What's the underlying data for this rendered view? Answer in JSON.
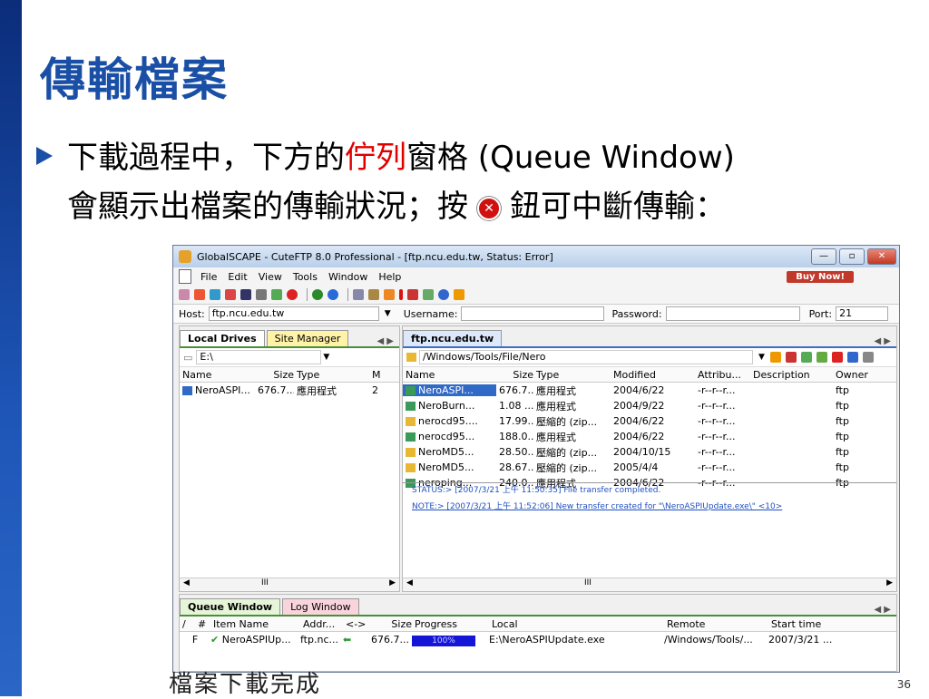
{
  "slide": {
    "title": "傳輸檔案",
    "line1_before": "下載過程中，下方的",
    "line1_red": "佇列",
    "line1_after": "窗格 (Queue Window)",
    "line2_before": "會顯示出檔案的傳輸狀況；按",
    "line2_after": "鈕可中斷傳輸：",
    "caption": "檔案下載完成",
    "page_number": "36"
  },
  "window": {
    "title": "GlobalSCAPE - CuteFTP 8.0 Professional - [ftp.ncu.edu.tw, Status: Error]",
    "menu": [
      "File",
      "Edit",
      "View",
      "Tools",
      "Window",
      "Help"
    ],
    "buy_now": "Buy Now!",
    "host_label": "Host:",
    "host_value": "ftp.ncu.edu.tw",
    "username_label": "Username:",
    "password_label": "Password:",
    "port_label": "Port:",
    "port_value": "21",
    "colors": {
      "accent": "#3169c6",
      "brand": "#1a4fa6",
      "error": "#d01010"
    }
  },
  "local": {
    "tabs": [
      "Local Drives",
      "Site Manager"
    ],
    "path": "E:\\",
    "headers": [
      "Name",
      "Size",
      "Type",
      "M"
    ],
    "rows": [
      {
        "name": "NeroASPI...",
        "size": "676.7...",
        "type": "應用程式",
        "m": "2"
      }
    ],
    "scroll": "III"
  },
  "remote": {
    "tab": "ftp.ncu.edu.tw",
    "path": "/Windows/Tools/File/Nero",
    "headers": [
      "Name",
      "Size",
      "Type",
      "Modified",
      "Attribu...",
      "Description",
      "Owner"
    ],
    "rows": [
      {
        "name": "NeroASPI...",
        "size": "676.7...",
        "type": "應用程式",
        "modified": "2004/6/22",
        "attr": "-r--r--r...",
        "owner": "ftp"
      },
      {
        "name": "NeroBurn...",
        "size": "1.08 ...",
        "type": "應用程式",
        "modified": "2004/9/22",
        "attr": "-r--r--r...",
        "owner": "ftp"
      },
      {
        "name": "nerocd95....",
        "size": "17.99...",
        "type": "壓縮的 (zip...",
        "modified": "2004/6/22",
        "attr": "-r--r--r...",
        "owner": "ftp"
      },
      {
        "name": "nerocd95...",
        "size": "188.0...",
        "type": "應用程式",
        "modified": "2004/6/22",
        "attr": "-r--r--r...",
        "owner": "ftp"
      },
      {
        "name": "NeroMD5...",
        "size": "28.50...",
        "type": "壓縮的 (zip...",
        "modified": "2004/10/15",
        "attr": "-r--r--r...",
        "owner": "ftp"
      },
      {
        "name": "NeroMD5...",
        "size": "28.67...",
        "type": "壓縮的 (zip...",
        "modified": "2005/4/4",
        "attr": "-r--r--r...",
        "owner": "ftp"
      },
      {
        "name": "neroping...",
        "size": "240.0...",
        "type": "應用程式",
        "modified": "2004/6/22",
        "attr": "-r--r--r...",
        "owner": "ftp"
      }
    ],
    "scroll": "III",
    "log": [
      "STATUS:>          [2007/3/21 上午 11:50:35] File transfer completed.",
      "NOTE:>            [2007/3/21 上午 11:52:06] New transfer created for \"\\NeroASPIUpdate.exe\\\" <10>"
    ]
  },
  "queue": {
    "tabs": [
      "Queue Window",
      "Log Window"
    ],
    "headers": [
      "/",
      "#",
      "Item Name",
      "Addr...",
      "<->",
      "Size",
      "Progress",
      "Local",
      "Remote",
      "Start time"
    ],
    "row": {
      "flag": "F",
      "name": "NeroASPIUp...",
      "addr": "ftp.nc...",
      "size": "676.7...",
      "progress_label": "100%",
      "progress": 1.0,
      "local": "E:\\NeroASPIUpdate.exe",
      "remote": "/Windows/Tools/...",
      "start": "2007/3/21 ..."
    }
  }
}
